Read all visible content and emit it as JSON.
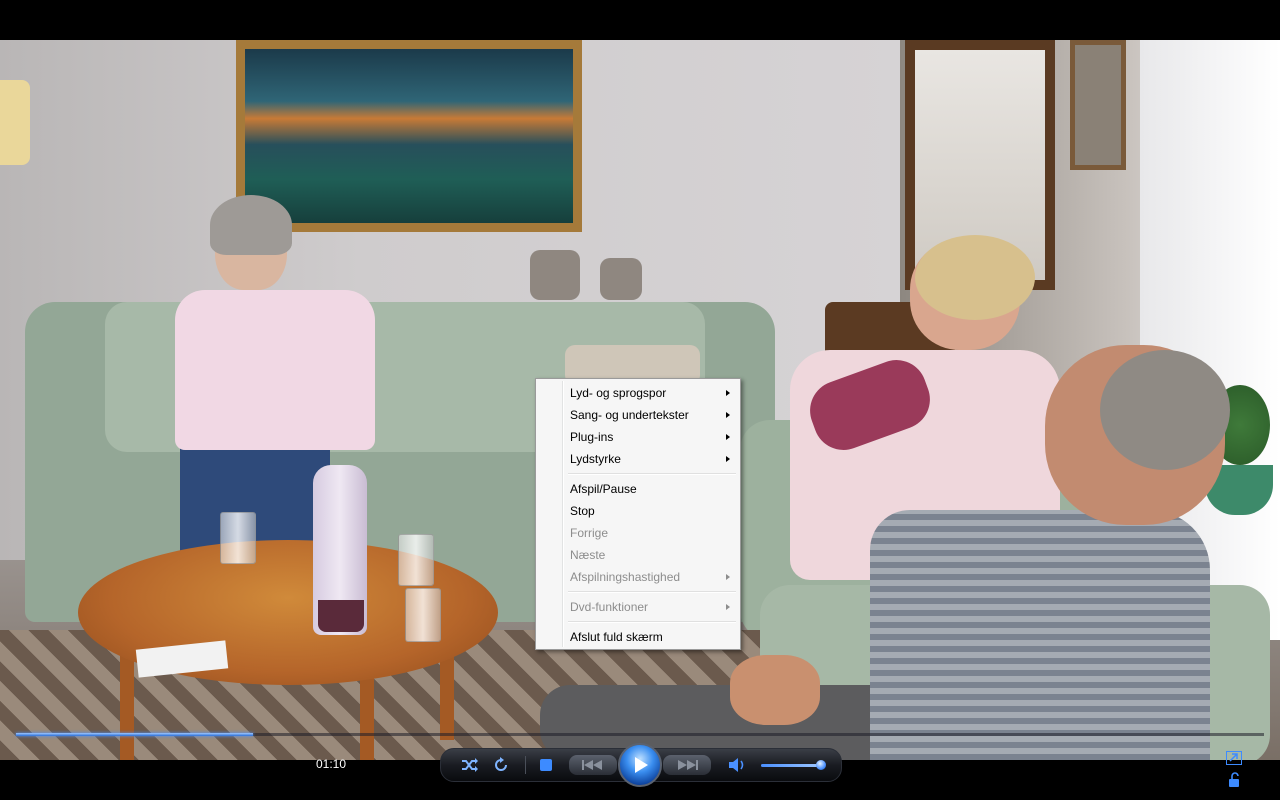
{
  "player": {
    "elapsed_time": "01:10",
    "seek_progress": 0.19,
    "volume_level": 0.97,
    "accent_color": "#2c6fd6"
  },
  "context_menu": {
    "groups": [
      [
        {
          "label": "Lyd- og sprogspor",
          "submenu": true,
          "enabled": true
        },
        {
          "label": "Sang- og undertekster",
          "submenu": true,
          "enabled": true
        },
        {
          "label": "Plug-ins",
          "submenu": true,
          "enabled": true
        },
        {
          "label": "Lydstyrke",
          "submenu": true,
          "enabled": true
        }
      ],
      [
        {
          "label": "Afspil/Pause",
          "submenu": false,
          "enabled": true
        },
        {
          "label": "Stop",
          "submenu": false,
          "enabled": true
        },
        {
          "label": "Forrige",
          "submenu": false,
          "enabled": false
        },
        {
          "label": "Næste",
          "submenu": false,
          "enabled": false
        },
        {
          "label": "Afspilningshastighed",
          "submenu": true,
          "enabled": false
        }
      ],
      [
        {
          "label": "Dvd-funktioner",
          "submenu": true,
          "enabled": false
        }
      ],
      [
        {
          "label": "Afslut fuld skærm",
          "submenu": false,
          "enabled": true
        }
      ]
    ]
  },
  "icons": {
    "shuffle": "shuffle-icon",
    "repeat": "repeat-icon",
    "stop": "stop-icon",
    "previous": "previous-icon",
    "play": "play-icon",
    "next": "next-icon",
    "volume": "speaker-icon",
    "exit_fullscreen": "exit-fullscreen-icon",
    "lock": "lock-icon"
  }
}
